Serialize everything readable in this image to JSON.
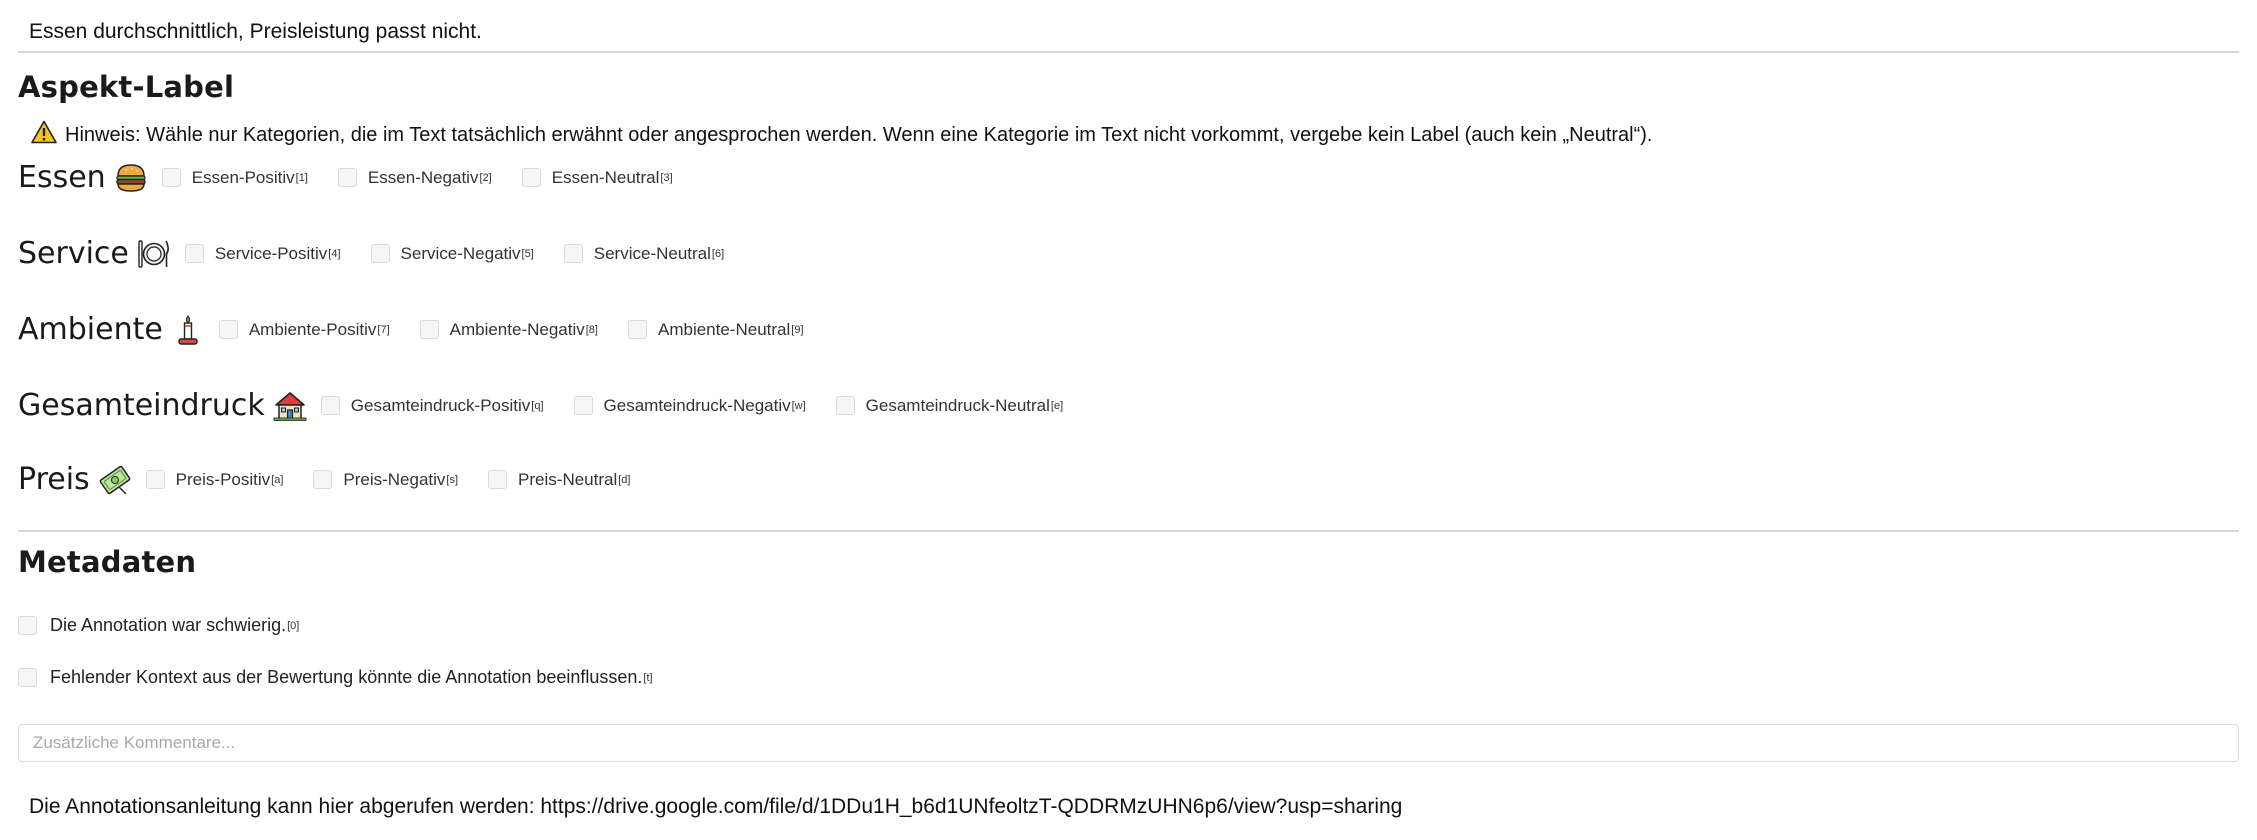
{
  "review": {
    "text": "Essen durchschnittlich, Preisleistung passt nicht."
  },
  "aspects": {
    "title": "Aspekt-Label",
    "hint": "Hinweis: Wähle nur Kategorien, die im Text tatsächlich erwähnt oder angesprochen werden. Wenn eine Kategorie im Text nicht vorkommt, vergebe kein Label (auch kein „Neutral“).",
    "hint_icon": "warning-icon",
    "rows": [
      {
        "name": "Essen",
        "icon": "burger-icon",
        "options": [
          {
            "label": "Essen-Positiv",
            "key": "[1]",
            "checked": false
          },
          {
            "label": "Essen-Negativ",
            "key": "[2]",
            "checked": false
          },
          {
            "label": "Essen-Neutral",
            "key": "[3]",
            "checked": false
          }
        ]
      },
      {
        "name": "Service",
        "icon": "plate-cutlery-icon",
        "options": [
          {
            "label": "Service-Positiv",
            "key": "[4]",
            "checked": false
          },
          {
            "label": "Service-Negativ",
            "key": "[5]",
            "checked": false
          },
          {
            "label": "Service-Neutral",
            "key": "[6]",
            "checked": false
          }
        ]
      },
      {
        "name": "Ambiente",
        "icon": "candle-icon",
        "options": [
          {
            "label": "Ambiente-Positiv",
            "key": "[7]",
            "checked": false
          },
          {
            "label": "Ambiente-Negativ",
            "key": "[8]",
            "checked": false
          },
          {
            "label": "Ambiente-Neutral",
            "key": "[9]",
            "checked": false
          }
        ]
      },
      {
        "name": "Gesamteindruck",
        "icon": "house-icon",
        "options": [
          {
            "label": "Gesamteindruck-Positiv",
            "key": "[q]",
            "checked": false
          },
          {
            "label": "Gesamteindruck-Negativ",
            "key": "[w]",
            "checked": false
          },
          {
            "label": "Gesamteindruck-Neutral",
            "key": "[e]",
            "checked": false
          }
        ]
      },
      {
        "name": "Preis",
        "icon": "money-icon",
        "options": [
          {
            "label": "Preis-Positiv",
            "key": "[a]",
            "checked": false
          },
          {
            "label": "Preis-Negativ",
            "key": "[s]",
            "checked": false
          },
          {
            "label": "Preis-Neutral",
            "key": "[d]",
            "checked": false
          }
        ]
      }
    ]
  },
  "metadata": {
    "title": "Metadaten",
    "items": [
      {
        "label": "Die Annotation war schwierig.",
        "key": "[0]",
        "checked": false
      },
      {
        "label": "Fehlender Kontext aus der Bewertung könnte die Annotation beeinflussen.",
        "key": "[t]",
        "checked": false
      }
    ],
    "comment_placeholder": "Zusätzliche Kommentare...",
    "comment_value": ""
  },
  "footer": {
    "guideline": "Die Annotationsanleitung kann hier abgerufen werden: https://drive.google.com/file/d/1DDu1H_b6d1UNfeoltzT-QDDRMzUHN6p6/view?usp=sharing"
  }
}
